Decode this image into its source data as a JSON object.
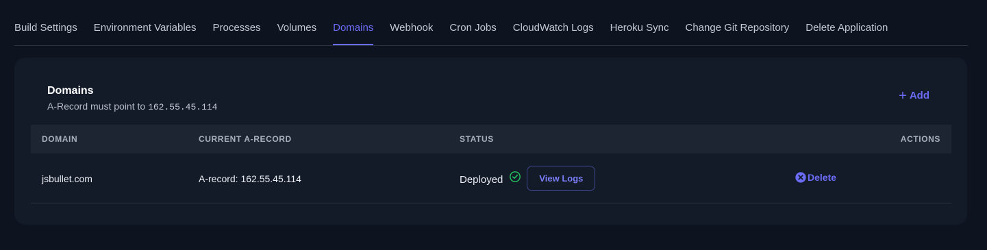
{
  "tabs": [
    {
      "label": "Build Settings"
    },
    {
      "label": "Environment Variables"
    },
    {
      "label": "Processes"
    },
    {
      "label": "Volumes"
    },
    {
      "label": "Domains",
      "active": true
    },
    {
      "label": "Webhook"
    },
    {
      "label": "Cron Jobs"
    },
    {
      "label": "CloudWatch Logs"
    },
    {
      "label": "Heroku Sync"
    },
    {
      "label": "Change Git Repository"
    },
    {
      "label": "Delete Application"
    }
  ],
  "card": {
    "title": "Domains",
    "subtitle_prefix": "A-Record must point to",
    "subtitle_ip": "162.55.45.114",
    "add_label": "Add",
    "add_icon": "plus-icon"
  },
  "table": {
    "headers": {
      "domain": "DOMAIN",
      "current_a_record": "CURRENT A-RECORD",
      "status": "STATUS",
      "actions": "ACTIONS"
    },
    "rows": [
      {
        "domain": "jsbullet.com",
        "a_record": "A-record: 162.55.45.114",
        "status": "Deployed",
        "status_icon": "check-circle-icon",
        "view_logs_label": "View Logs",
        "delete_label": "Delete",
        "delete_icon": "x-circle-icon"
      }
    ]
  },
  "colors": {
    "accent": "#6b6cf6",
    "success": "#22c55e",
    "background": "#0e1320",
    "card": "#141b28",
    "table_header": "#1d2533"
  }
}
